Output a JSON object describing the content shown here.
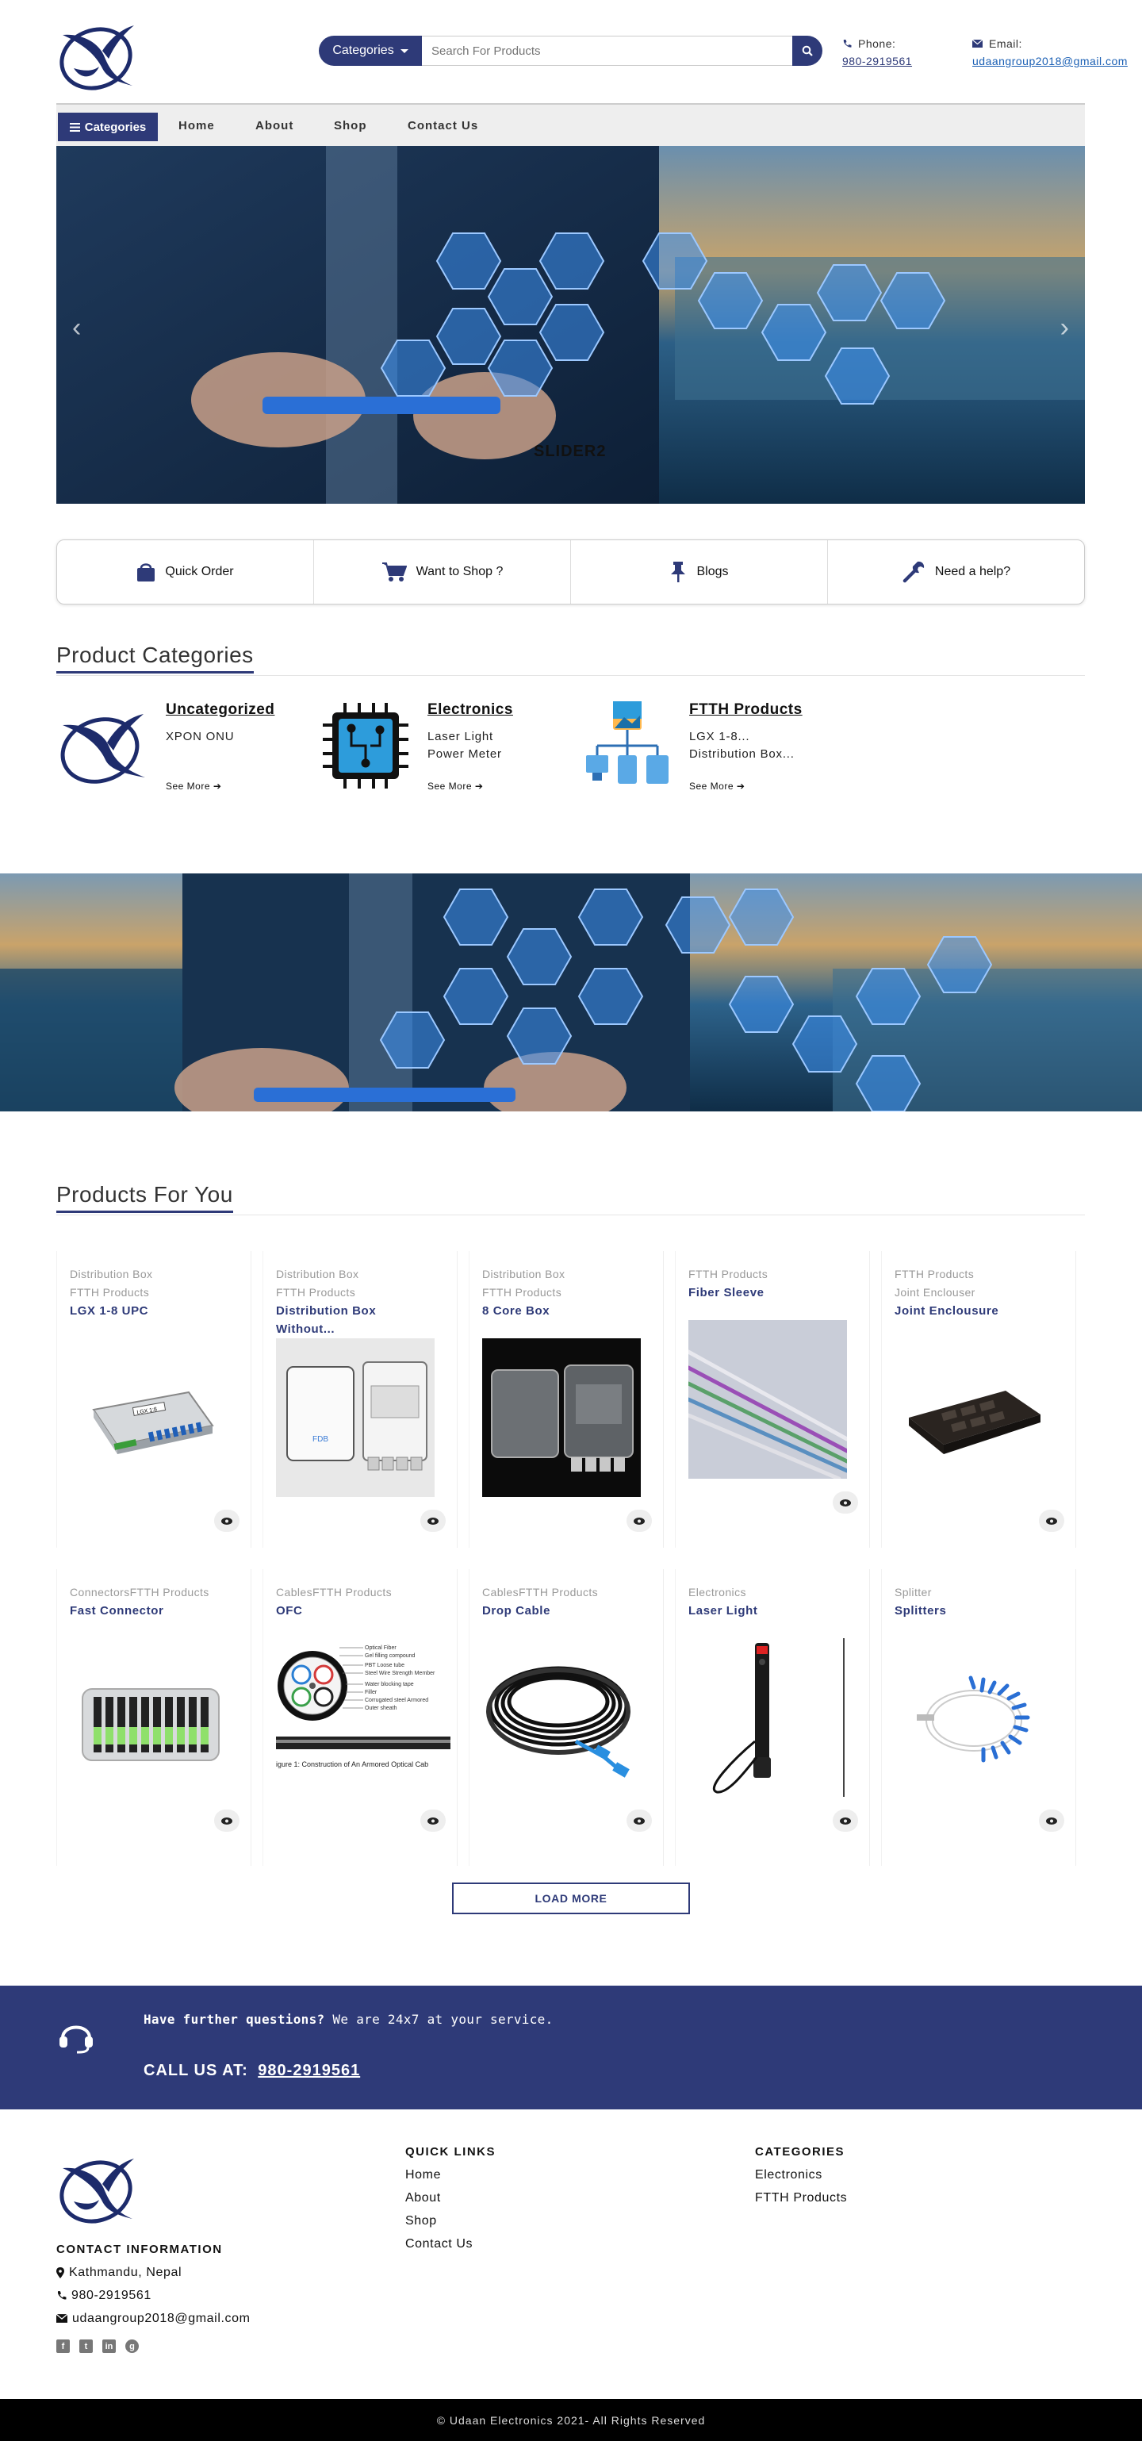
{
  "header": {
    "search_category_label": "Categories",
    "search_placeholder": "Search For Products",
    "phone_label": "Phone:",
    "phone_value": "980-2919561",
    "email_label": "Email:",
    "email_value": "udaangroup2018@gmail.com"
  },
  "nav": {
    "categories_label": "Categories",
    "items": [
      {
        "label": "Home"
      },
      {
        "label": "About"
      },
      {
        "label": "Shop"
      },
      {
        "label": "Contact Us"
      }
    ]
  },
  "hero": {
    "slide_label": "SLIDER2"
  },
  "quick_links": [
    {
      "label": "Quick Order",
      "icon": "shopping-bag-icon"
    },
    {
      "label": "Want to Shop ?",
      "icon": "cart-icon"
    },
    {
      "label": "Blogs",
      "icon": "pin-icon"
    },
    {
      "label": "Need a help?",
      "icon": "wrench-icon"
    }
  ],
  "product_categories": {
    "title": "Product Categories",
    "see_more": "See More",
    "items": [
      {
        "name": "Uncategorized",
        "line1": "XPON ONU",
        "line2": ""
      },
      {
        "name": "Electronics",
        "line1": "Laser Light",
        "line2": "Power Meter"
      },
      {
        "name": "FTTH Products",
        "line1": "LGX 1-8...",
        "line2": "Distribution Box..."
      }
    ]
  },
  "products": {
    "title": "Products For You",
    "items": [
      {
        "cat1": "Distribution Box",
        "cat2": "FTTH Products",
        "name1": "LGX 1-8 UPC",
        "name2": ""
      },
      {
        "cat1": "Distribution Box",
        "cat2": "FTTH Products",
        "name1": "Distribution Box",
        "name2": "Without..."
      },
      {
        "cat1": "Distribution Box",
        "cat2": "FTTH Products",
        "name1": "8 Core Box",
        "name2": ""
      },
      {
        "cat1": "FTTH Products",
        "cat2": "",
        "name1": "Fiber Sleeve",
        "name2": ""
      },
      {
        "cat1": "FTTH Products",
        "cat2": "Joint Enclouser",
        "name1": "Joint Enclousure",
        "name2": ""
      },
      {
        "cat1": "ConnectorsFTTH Products",
        "cat2": "",
        "name1": "Fast Connector",
        "name2": ""
      },
      {
        "cat1": "CablesFTTH Products",
        "cat2": "",
        "name1": "OFC",
        "name2": ""
      },
      {
        "cat1": "CablesFTTH Products",
        "cat2": "",
        "name1": "Drop Cable",
        "name2": ""
      },
      {
        "cat1": "Electronics",
        "cat2": "",
        "name1": "Laser Light",
        "name2": ""
      },
      {
        "cat1": "Splitter",
        "cat2": "",
        "name1": "Splitters",
        "name2": ""
      }
    ],
    "load_more": "LOAD MORE",
    "ofc_caption": "igure 1: Construction of An Armored Optical Cab",
    "ofc_labels": [
      "Optical Fiber",
      "Gel filling compound",
      "PBT Loose tube",
      "Steel Wire Strength Member",
      "Water blocking tape",
      "Filler",
      "Corrugated steel Armored",
      "Outer sheath"
    ],
    "lgx_label": "LGX 1:8",
    "fdb_label": "FDB"
  },
  "cta": {
    "question_bold": "Have further questions?",
    "question_rest": " We are 24x7 at your service.",
    "call_label": "CALL US AT:",
    "call_number": "980-2919561"
  },
  "footer": {
    "contact_title": "CONTACT INFORMATION",
    "address": "Kathmandu, Nepal",
    "phone": "980-2919561",
    "email": "udaangroup2018@gmail.com",
    "quick_links_title": "QUICK LINKS",
    "quick_links": [
      "Home",
      "About",
      "Shop",
      "Contact Us"
    ],
    "categories_title": "CATEGORIES",
    "categories": [
      "Electronics",
      "FTTH Products"
    ],
    "social": [
      "facebook-icon",
      "twitter-icon",
      "linkedin-icon",
      "google-plus-icon"
    ],
    "copyright": "© Udaan Electronics 2021- All Rights Reserved"
  },
  "colors": {
    "brand": "#2e3a78",
    "link": "#1a5fb4"
  }
}
